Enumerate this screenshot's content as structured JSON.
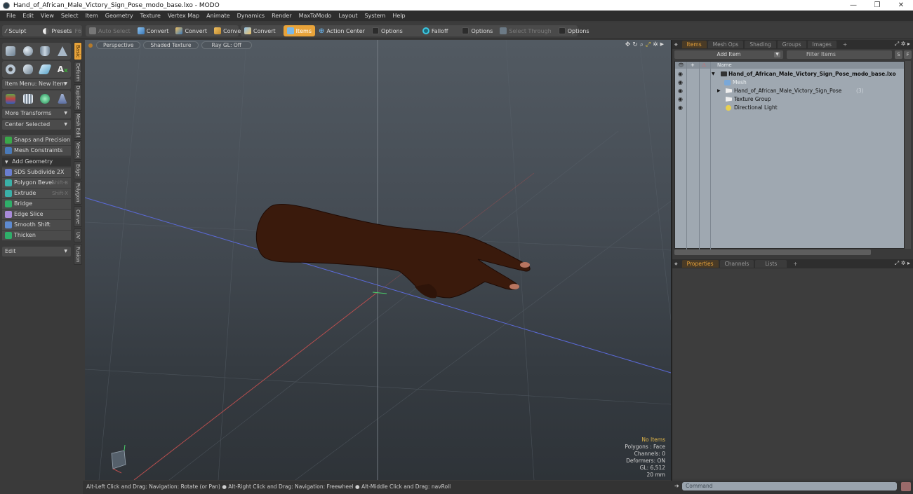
{
  "window": {
    "title": "Hand_of_African_Male_Victory_Sign_Pose_modo_base.lxo - MODO",
    "minimize": "—",
    "restore": "❐",
    "close": "✕"
  },
  "menu": [
    "File",
    "Edit",
    "View",
    "Select",
    "Item",
    "Geometry",
    "Texture",
    "Vertex Map",
    "Animate",
    "Dynamics",
    "Render",
    "MaxToModo",
    "Layout",
    "System",
    "Help"
  ],
  "toolbar": {
    "sculpt": "Sculpt",
    "presets": "Presets",
    "presets_shortcut": "F6",
    "auto_select": "Auto Select",
    "convert1": "Convert",
    "convert2": "Convert",
    "convert3": "Convert",
    "convert4": "Convert",
    "items": "Items",
    "action_center": "Action Center",
    "options1": "Options",
    "falloff": "Falloff",
    "options2": "Options",
    "select_through": "Select Through",
    "options3": "Options"
  },
  "left_panel": {
    "item_menu": "Item Menu: New Item",
    "more_transforms": "More Transforms",
    "center_selected": "Center Selected",
    "snaps": "Snaps and Precision",
    "mesh_constraints": "Mesh Constraints",
    "add_geometry": "Add Geometry",
    "tools": [
      {
        "label": "SDS Subdivide 2X",
        "shortcut": ""
      },
      {
        "label": "Polygon Bevel",
        "shortcut": "Shift-B"
      },
      {
        "label": "Extrude",
        "shortcut": "Shift-X"
      },
      {
        "label": "Bridge",
        "shortcut": ""
      },
      {
        "label": "Edge Slice",
        "shortcut": ""
      },
      {
        "label": "Smooth Shift",
        "shortcut": ""
      },
      {
        "label": "Thicken",
        "shortcut": ""
      }
    ],
    "edit": "Edit"
  },
  "vertical_tabs": [
    "Basic",
    "Deform",
    "Duplicate",
    "Mesh Edit",
    "Vertex",
    "Edge",
    "Polygon",
    "Curve",
    "UV",
    "Fusion"
  ],
  "viewport": {
    "view": "Perspective",
    "shading": "Shaded Texture",
    "raygl": "Ray GL: Off",
    "stats": {
      "selection": "No Items",
      "polygons": "Polygons : Face",
      "channels": "Channels: 0",
      "deformers": "Deformers: ON",
      "gl": "GL: 6,512",
      "unit": "20 mm"
    }
  },
  "status_bar": "Alt-Left Click and Drag: Navigation: Rotate (or Pan) ● Alt-Right Click and Drag: Navigation: Freewheel ● Alt-Middle Click and Drag: navRoll",
  "items_panel": {
    "tabs": [
      "Items",
      "Mesh Ops",
      "Shading",
      "Groups",
      "Images",
      "+"
    ],
    "add_item": "Add Item",
    "filter_placeholder": "Filter Items",
    "s_btn": "S",
    "f_btn": "F",
    "column_name": "Name",
    "tree": [
      {
        "label": "Hand_of_African_Male_Victory_Sign_Pose_modo_base.lxo",
        "bold": true,
        "expander": "▼"
      },
      {
        "label": "Mesh",
        "dim": true,
        "expander": ""
      },
      {
        "label": "Hand_of_African_Male_Victory_Sign_Pose",
        "suffix": "(3)",
        "expander": "▶"
      },
      {
        "label": "Texture Group",
        "expander": ""
      },
      {
        "label": "Directional Light",
        "expander": ""
      }
    ]
  },
  "properties_panel": {
    "tabs": [
      "Properties",
      "Channels",
      "Lists",
      "+"
    ]
  },
  "command": {
    "placeholder": "Command"
  }
}
